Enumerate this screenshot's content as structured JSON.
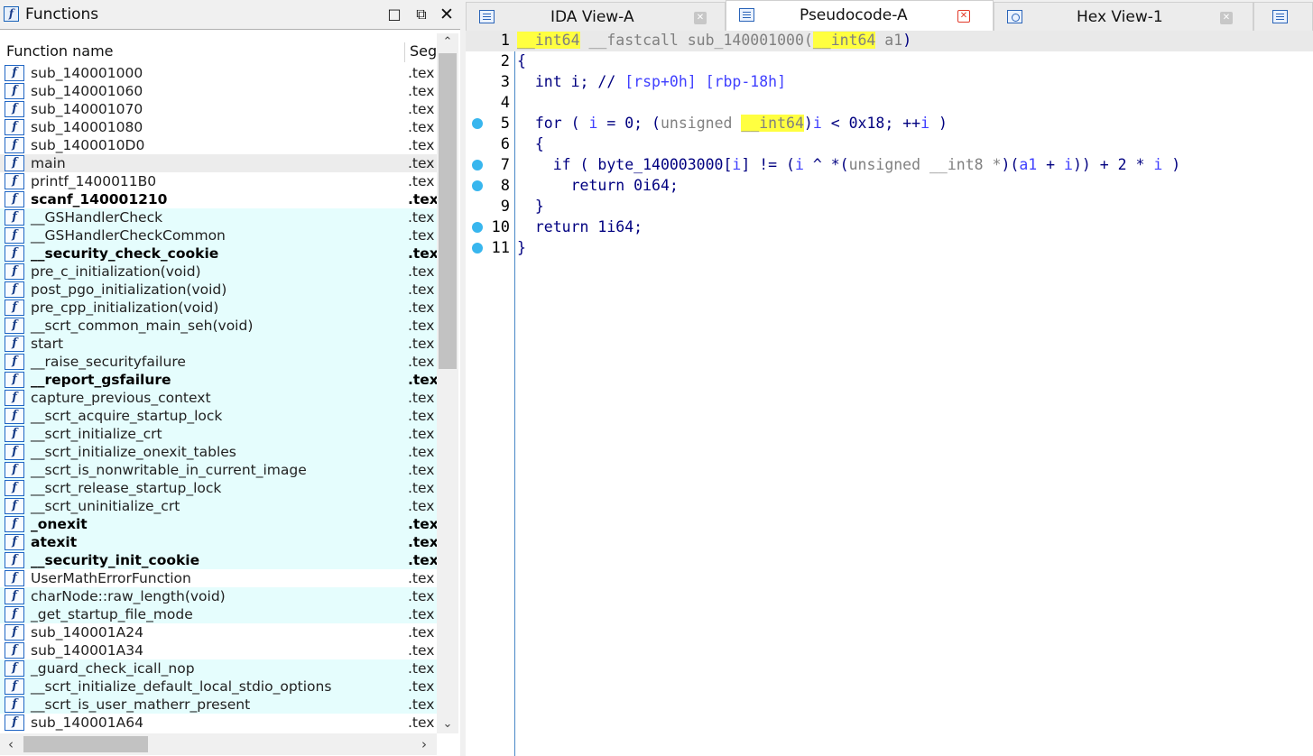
{
  "functions_window": {
    "title": "Functions",
    "columns": {
      "name": "Function name",
      "segment": "Seg"
    },
    "rows": [
      {
        "name": "sub_140001000",
        "seg": ".tex",
        "style": ""
      },
      {
        "name": "sub_140001060",
        "seg": ".tex",
        "style": ""
      },
      {
        "name": "sub_140001070",
        "seg": ".tex",
        "style": ""
      },
      {
        "name": "sub_140001080",
        "seg": ".tex",
        "style": ""
      },
      {
        "name": "sub_1400010D0",
        "seg": ".tex",
        "style": ""
      },
      {
        "name": "main",
        "seg": ".tex",
        "style": "sel"
      },
      {
        "name": "printf_1400011B0",
        "seg": ".tex",
        "style": ""
      },
      {
        "name": "scanf_140001210",
        "seg": ".tex",
        "style": "bold"
      },
      {
        "name": "__GSHandlerCheck",
        "seg": ".tex",
        "style": "lib"
      },
      {
        "name": "__GSHandlerCheckCommon",
        "seg": ".tex",
        "style": "lib"
      },
      {
        "name": "__security_check_cookie",
        "seg": ".tex",
        "style": "lib bold"
      },
      {
        "name": "pre_c_initialization(void)",
        "seg": ".tex",
        "style": "lib"
      },
      {
        "name": "post_pgo_initialization(void)",
        "seg": ".tex",
        "style": "lib"
      },
      {
        "name": "pre_cpp_initialization(void)",
        "seg": ".tex",
        "style": "lib"
      },
      {
        "name": "__scrt_common_main_seh(void)",
        "seg": ".tex",
        "style": "lib"
      },
      {
        "name": "start",
        "seg": ".tex",
        "style": "lib"
      },
      {
        "name": "__raise_securityfailure",
        "seg": ".tex",
        "style": "lib"
      },
      {
        "name": "__report_gsfailure",
        "seg": ".tex",
        "style": "lib bold"
      },
      {
        "name": "capture_previous_context",
        "seg": ".tex",
        "style": "lib"
      },
      {
        "name": "__scrt_acquire_startup_lock",
        "seg": ".tex",
        "style": "lib"
      },
      {
        "name": "__scrt_initialize_crt",
        "seg": ".tex",
        "style": "lib"
      },
      {
        "name": "__scrt_initialize_onexit_tables",
        "seg": ".tex",
        "style": "lib"
      },
      {
        "name": "__scrt_is_nonwritable_in_current_image",
        "seg": ".tex",
        "style": "lib"
      },
      {
        "name": "__scrt_release_startup_lock",
        "seg": ".tex",
        "style": "lib"
      },
      {
        "name": "__scrt_uninitialize_crt",
        "seg": ".tex",
        "style": "lib"
      },
      {
        "name": "_onexit",
        "seg": ".tex",
        "style": "lib bold"
      },
      {
        "name": "atexit",
        "seg": ".tex",
        "style": "lib bold"
      },
      {
        "name": "__security_init_cookie",
        "seg": ".tex",
        "style": "lib bold"
      },
      {
        "name": "UserMathErrorFunction",
        "seg": ".tex",
        "style": ""
      },
      {
        "name": "charNode::raw_length(void)",
        "seg": ".tex",
        "style": "lib"
      },
      {
        "name": "_get_startup_file_mode",
        "seg": ".tex",
        "style": "lib"
      },
      {
        "name": "sub_140001A24",
        "seg": ".tex",
        "style": ""
      },
      {
        "name": "sub_140001A34",
        "seg": ".tex",
        "style": ""
      },
      {
        "name": "_guard_check_icall_nop",
        "seg": ".tex",
        "style": "lib"
      },
      {
        "name": "__scrt_initialize_default_local_stdio_options",
        "seg": ".tex",
        "style": "lib"
      },
      {
        "name": "__scrt_is_user_matherr_present",
        "seg": ".tex",
        "style": "lib"
      },
      {
        "name": "sub_140001A64",
        "seg": ".tex",
        "style": ""
      }
    ]
  },
  "tabs": [
    {
      "label": "IDA View-A",
      "active": false
    },
    {
      "label": "Pseudocode-A",
      "active": true
    },
    {
      "label": "Hex View-1",
      "active": false
    }
  ],
  "pseudocode": {
    "lines": [
      {
        "num": "1",
        "bp": false
      },
      {
        "num": "2",
        "bp": false
      },
      {
        "num": "3",
        "bp": false
      },
      {
        "num": "4",
        "bp": false
      },
      {
        "num": "5",
        "bp": true
      },
      {
        "num": "6",
        "bp": false
      },
      {
        "num": "7",
        "bp": true
      },
      {
        "num": "8",
        "bp": true
      },
      {
        "num": "9",
        "bp": false
      },
      {
        "num": "10",
        "bp": true
      },
      {
        "num": "11",
        "bp": true
      }
    ],
    "tokens": {
      "l1_type": "__int64",
      "l1_conv": " __fastcall sub_140001000(",
      "l1_argtype": "__int64",
      "l1_arg": " a1",
      "l1_close": ")",
      "l2": "{",
      "l3_decl": "  int i; // ",
      "l3_comment": "[rsp+0h] [rbp-18h]",
      "l5_a": "  for ( ",
      "l5_i1": "i",
      "l5_b": " = 0; (",
      "l5_uns": "unsigned ",
      "l5_type": "__int64",
      "l5_c": ")",
      "l5_i2": "i",
      "l5_d": " < 0x18; ++",
      "l5_i3": "i",
      "l5_e": " )",
      "l6": "  {",
      "l7_a": "    if ( byte_140003000[",
      "l7_i1": "i",
      "l7_b": "] != (",
      "l7_i2": "i",
      "l7_c": " ^ *(",
      "l7_uns": "unsigned __int8 *",
      "l7_d": ")(",
      "l7_a1": "a1",
      "l7_e": " + ",
      "l7_i3": "i",
      "l7_f": ")) + 2 * ",
      "l7_i4": "i",
      "l7_g": " )",
      "l8": "      return 0i64;",
      "l9": "  }",
      "l10": "  return 1i64;",
      "l11": "}"
    }
  }
}
